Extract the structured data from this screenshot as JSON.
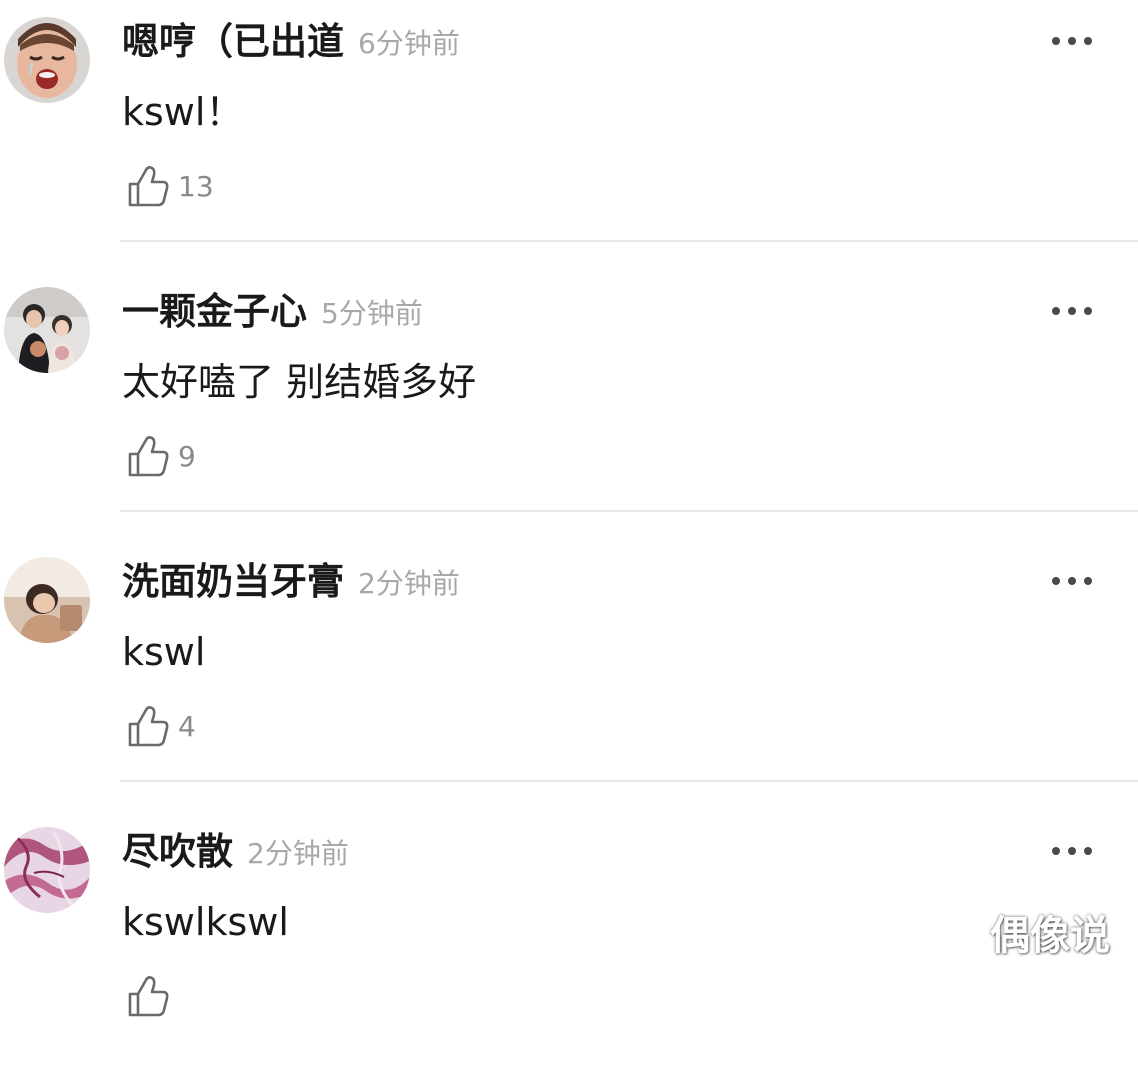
{
  "comments": [
    {
      "username": "嗯哼（已出道",
      "time": "6分钟前",
      "text": "kswl！",
      "likes": "13",
      "avatar_icon": "crying-child-avatar"
    },
    {
      "username": "一颗金子心",
      "time": "5分钟前",
      "text": "太好嗑了 别结婚多好",
      "likes": "9",
      "avatar_icon": "couple-photo-avatar"
    },
    {
      "username": "洗面奶当牙膏",
      "time": "2分钟前",
      "text": "kswl",
      "likes": "4",
      "avatar_icon": "girl-photo-avatar"
    },
    {
      "username": "尽吹散",
      "time": "2分钟前",
      "text": "kswlkswl",
      "likes": "",
      "avatar_icon": "pink-marble-avatar"
    }
  ],
  "icons": {
    "like": "thumbs-up-icon",
    "more": "more-options-icon"
  },
  "colors": {
    "text": "#1a1a1a",
    "muted": "#a8a8a8",
    "divider": "#e8e8e8"
  },
  "watermark": "偶像说"
}
